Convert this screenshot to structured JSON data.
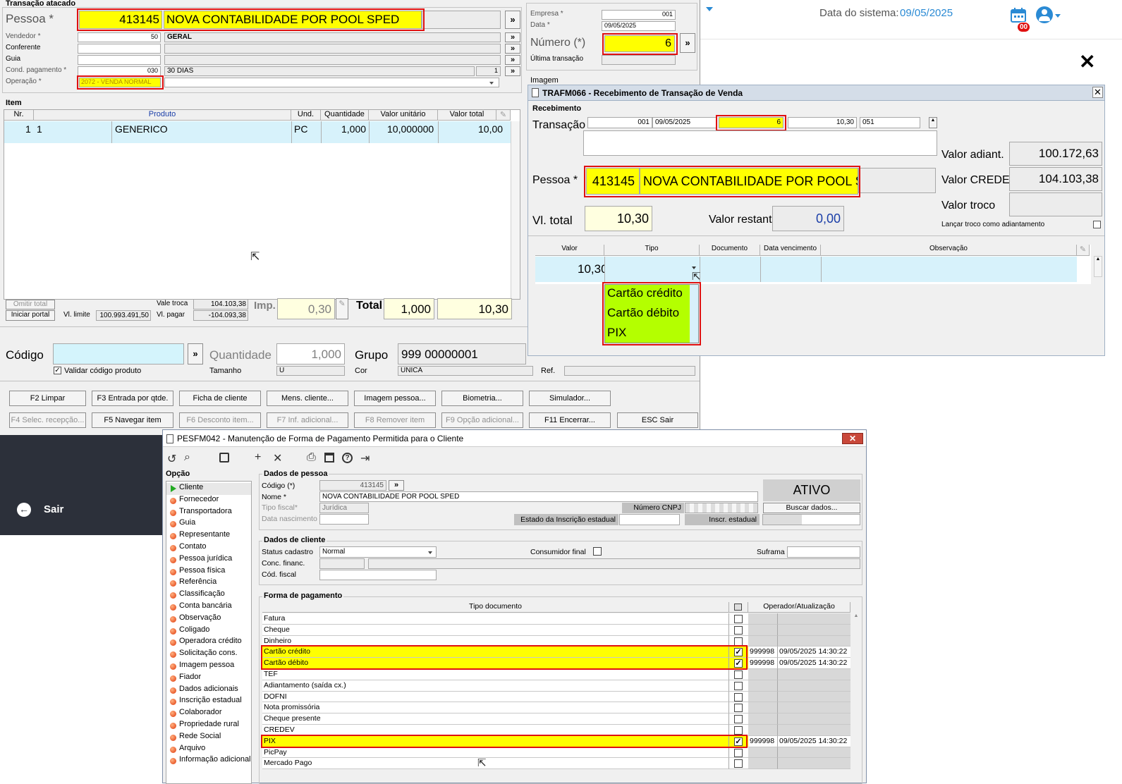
{
  "topbar": {
    "date_label": "Data do sistema:",
    "date_value": "09/05/2025",
    "calendar_badge": "00"
  },
  "sidebar": {
    "exit_label": "Sair"
  },
  "transacao": {
    "section_title": "Transação atacado",
    "pessoa_label": "Pessoa *",
    "pessoa_code": "413145",
    "pessoa_name": "NOVA CONTABILIDADE POR POOL SPED",
    "vendedor_label": "Vendedor *",
    "vendedor_code": "50",
    "vendedor_name": "GERAL",
    "conferente_label": "Conferente",
    "guia_label": "Guia",
    "cond_label": "Cond. pagamento *",
    "cond_code": "030",
    "cond_name": "30 DIAS",
    "cond_num": "1",
    "operacao_label": "Operação *",
    "operacao_value": "2072 - VENDA NORMAL",
    "empresa_label": "Empresa *",
    "empresa_value": "001",
    "data_label": "Data *",
    "data_value": "09/05/2025",
    "numero_label": "Número (*)",
    "numero_value": "6",
    "ultima_label": "Última transação",
    "imagem_label": "Imagem",
    "item_section": "Item",
    "item_headers": [
      "Nr.",
      "Produto",
      "Und.",
      "Quantidade",
      "Valor unitário",
      "Valor total"
    ],
    "item_row": {
      "nr": "1",
      "prod_code": "1",
      "prod_name": "GENERICO",
      "und": "PC",
      "qtd": "1,000",
      "unit": "10,000000",
      "total": "10,00"
    },
    "omitir_label": "Omitir total",
    "iniciar_label": "Iniciar portal",
    "vl_limite_label": "Vl. limite",
    "vl_limite_value": "100.993.491,50",
    "vale_troca_label": "Vale troca",
    "vale_troca_value": "104.103,38",
    "vl_pagar_label": "Vl. pagar",
    "vl_pagar_value": "-104.093,38",
    "imp_label": "Imp.",
    "imp_value": "0,30",
    "total_label": "Total",
    "total_qty": "1,000",
    "total_value": "10,30",
    "codigo_label": "Código",
    "validar_label": "Validar código produto",
    "quantidade_label": "Quantidade",
    "quantidade_value": "1,000",
    "tamanho_label": "Tamanho",
    "tamanho_value": "U",
    "grupo_label": "Grupo",
    "grupo_value": "999 00000001",
    "cor_label": "Cor",
    "cor_value": "UNICA",
    "ref_label": "Ref.",
    "buttons_row1": [
      "F2 Limpar",
      "F3 Entrada por qtde.",
      "Ficha de cliente",
      "Mens. cliente...",
      "Imagem pessoa...",
      "Biometria...",
      "Simulador..."
    ],
    "buttons_row2": [
      "F4 Selec. recepção...",
      "F5 Navegar item",
      "F6 Desconto item...",
      "F7 Inf. adicional...",
      "F8 Remover item",
      "F9 Opção adicional...",
      "F11 Encerrar...",
      "ESC Sair"
    ]
  },
  "recebimento": {
    "title": "TRAFM066 - Recebimento de Transação de Venda",
    "tab_label": "Recebimento",
    "transacao_label": "Transação *",
    "trans_empresa": "001",
    "trans_data": "09/05/2025",
    "trans_numero": "6",
    "trans_valor": "10,30",
    "trans_cod": "051",
    "pessoa_label": "Pessoa *",
    "pessoa_code": "413145",
    "pessoa_name": "NOVA CONTABILIDADE POR POOL SPED",
    "vl_total_label": "Vl. total",
    "vl_total_value": "10,30",
    "valor_restante_label": "Valor restante",
    "valor_restante_value": "0,00",
    "valor_adiant_label": "Valor adiant.",
    "valor_adiant_value": "100.172,63",
    "valor_credev_label": "Valor CREDEV",
    "valor_credev_value": "104.103,38",
    "valor_troco_label": "Valor troco",
    "lancar_label": "Lançar troco como adiantamento",
    "grid_headers": [
      "Valor",
      "Tipo",
      "Documento",
      "Data vencimento",
      "Observação"
    ],
    "grid_valor": "10,30",
    "tipo_options": [
      "Cartão crédito",
      "Cartão débito",
      "PIX"
    ]
  },
  "pesfm": {
    "title": "PESFM042 - Manutenção de Forma de Pagamento Permitida para o Cliente",
    "opcao_label": "Opção",
    "opcoes": [
      "Cliente",
      "Fornecedor",
      "Transportadora",
      "Guia",
      "Representante",
      "Contato",
      "Pessoa jurídica",
      "Pessoa física",
      "Referência",
      "Classificação",
      "Conta bancária",
      "Observação",
      "Coligado",
      "Operadora crédito",
      "Solicitação cons.",
      "Imagem pessoa",
      "Fiador",
      "Dados adicionais",
      "Inscrição estadual",
      "Colaborador",
      "Propriedade rural",
      "Rede Social",
      "Arquivo",
      "Informação adicional"
    ],
    "dados_pessoa_label": "Dados de pessoa",
    "codigo_label": "Código (*)",
    "codigo_value": "413145",
    "nome_label": "Nome *",
    "nome_value": "NOVA CONTABILIDADE POR POOL SPED",
    "tipo_fiscal_label": "Tipo fiscal*",
    "tipo_fiscal_value": "Jurídica",
    "data_nasc_label": "Data nascimento",
    "status_badge": "ATIVO",
    "numero_cnpj_label": "Número CNPJ",
    "buscar_label": "Buscar dados...",
    "estado_ie_label": "Estado da Inscrição estadual",
    "inscr_estadual_label": "Inscr. estadual",
    "dados_cliente_label": "Dados de cliente",
    "status_cadastro_label": "Status cadastro",
    "status_cadastro_value": "Normal",
    "consumidor_label": "Consumidor final",
    "suframa_label": "Suframa",
    "conc_label": "Conc. financ.",
    "cod_fiscal_label": "Cód. fiscal",
    "forma_pag_label": "Forma de pagamento",
    "tipo_doc_header": "Tipo documento",
    "operador_header": "Operador/Atualização",
    "pagamentos": [
      {
        "name": "Fatura",
        "checked": false,
        "op": "",
        "dt": ""
      },
      {
        "name": "Cheque",
        "checked": false,
        "op": "",
        "dt": ""
      },
      {
        "name": "Dinheiro",
        "checked": false,
        "op": "",
        "dt": ""
      },
      {
        "name": "Cartão crédito",
        "checked": true,
        "op": "999998",
        "dt": "09/05/2025 14:30:22"
      },
      {
        "name": "Cartão débito",
        "checked": true,
        "op": "999998",
        "dt": "09/05/2025 14:30:22"
      },
      {
        "name": "TEF",
        "checked": false,
        "op": "",
        "dt": ""
      },
      {
        "name": "Adiantamento (saída cx.)",
        "checked": false,
        "op": "",
        "dt": ""
      },
      {
        "name": "DOFNI",
        "checked": false,
        "op": "",
        "dt": ""
      },
      {
        "name": "Nota promissória",
        "checked": false,
        "op": "",
        "dt": ""
      },
      {
        "name": "Cheque presente",
        "checked": false,
        "op": "",
        "dt": ""
      },
      {
        "name": "CREDEV",
        "checked": false,
        "op": "",
        "dt": ""
      },
      {
        "name": "PIX",
        "checked": true,
        "op": "999998",
        "dt": "09/05/2025 14:30:22"
      },
      {
        "name": "PicPay",
        "checked": false,
        "op": "",
        "dt": ""
      },
      {
        "name": "Mercado Pago",
        "checked": false,
        "op": "",
        "dt": ""
      }
    ]
  }
}
